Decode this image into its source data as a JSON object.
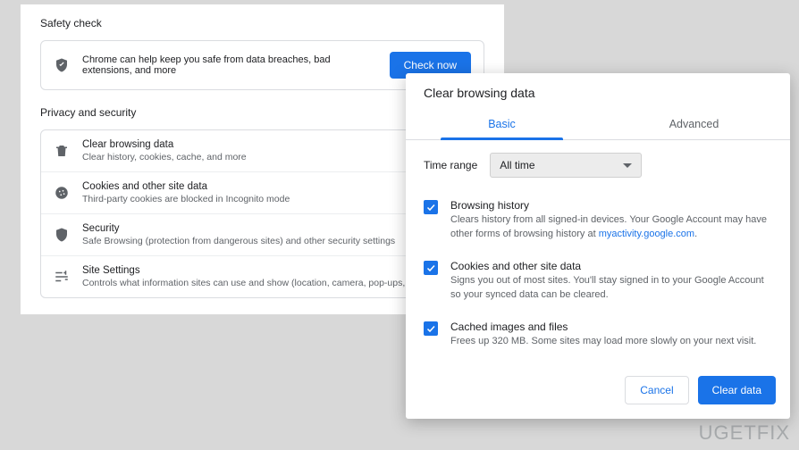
{
  "colors": {
    "accent": "#1a73e8"
  },
  "watermark": "UGETFIX",
  "settings": {
    "safety": {
      "heading": "Safety check",
      "message": "Chrome can help keep you safe from data breaches, bad extensions, and more",
      "button": "Check now"
    },
    "privacy": {
      "heading": "Privacy and security",
      "rows": [
        {
          "icon": "trash-icon",
          "title": "Clear browsing data",
          "sub": "Clear history, cookies, cache, and more"
        },
        {
          "icon": "cookie-icon",
          "title": "Cookies and other site data",
          "sub": "Third-party cookies are blocked in Incognito mode"
        },
        {
          "icon": "shield-icon",
          "title": "Security",
          "sub": "Safe Browsing (protection from dangerous sites) and other security settings"
        },
        {
          "icon": "tune-icon",
          "title": "Site Settings",
          "sub": "Controls what information sites can use and show (location, camera, pop-ups, and more)"
        }
      ]
    }
  },
  "dialog": {
    "title": "Clear browsing data",
    "tabs": {
      "basic": "Basic",
      "advanced": "Advanced",
      "active": "basic"
    },
    "time_range": {
      "label": "Time range",
      "value": "All time"
    },
    "options": [
      {
        "checked": true,
        "title": "Browsing history",
        "desc_prefix": "Clears history from all signed-in devices. Your Google Account may have other forms of browsing history at ",
        "desc_link": "myactivity.google.com",
        "desc_suffix": "."
      },
      {
        "checked": true,
        "title": "Cookies and other site data",
        "desc": "Signs you out of most sites. You'll stay signed in to your Google Account so your synced data can be cleared."
      },
      {
        "checked": true,
        "title": "Cached images and files",
        "desc": "Frees up 320 MB. Some sites may load more slowly on your next visit."
      }
    ],
    "actions": {
      "cancel": "Cancel",
      "confirm": "Clear data"
    }
  }
}
